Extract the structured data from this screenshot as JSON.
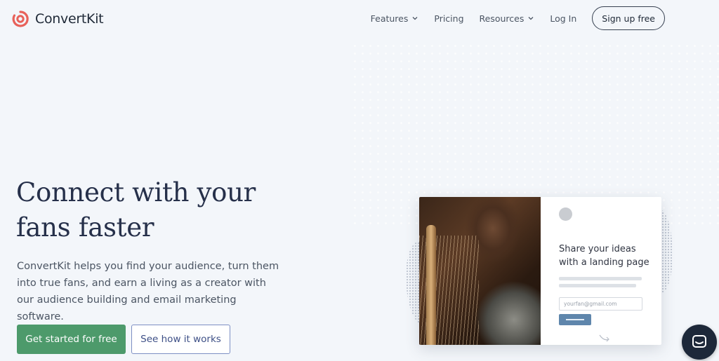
{
  "header": {
    "logo_text": "ConvertKit",
    "nav": [
      {
        "label": "Features",
        "has_dropdown": true
      },
      {
        "label": "Pricing",
        "has_dropdown": false
      },
      {
        "label": "Resources",
        "has_dropdown": true
      },
      {
        "label": "Log In",
        "has_dropdown": false
      }
    ],
    "signup_label": "Sign up free"
  },
  "hero": {
    "title_line1": "Connect with your",
    "title_line2": "fans faster",
    "description": "ConvertKit helps you find your audience, turn them into true fans, and earn a living as a creator with our audience building and email marketing software.",
    "cta_primary": "Get started for free",
    "cta_secondary": "See how it works"
  },
  "preview_card": {
    "title_line1": "Share your ideas",
    "title_line2": "with a landing page",
    "email_placeholder": "yourfan@gmail.com"
  },
  "colors": {
    "background": "#f3f6fa",
    "brand": "#e8615a",
    "primary_button": "#4d9a6b",
    "secondary_button_text": "#3d4f86",
    "chat_button": "#1d2839"
  },
  "icons": {
    "logo": "convertkit-logo-icon",
    "nav_chevron": "chevron-down-icon",
    "chat": "chat-icon"
  }
}
